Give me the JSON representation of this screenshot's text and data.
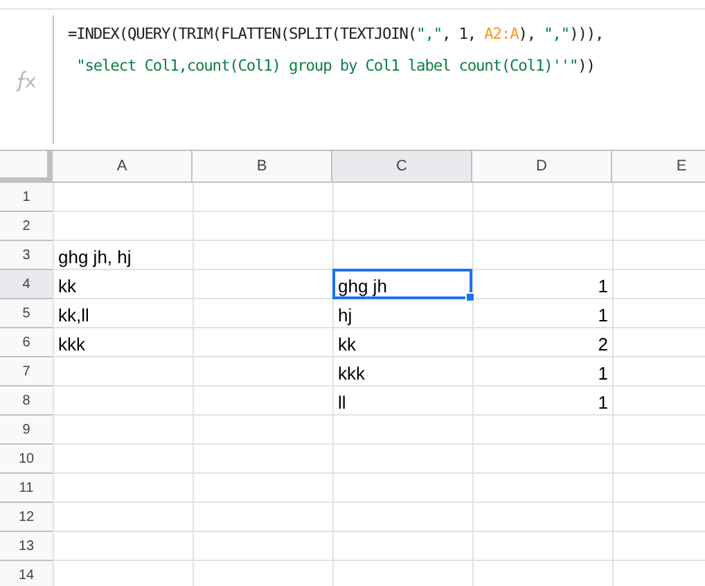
{
  "formula_bar": {
    "lines": [
      [
        {
          "kind": "plain",
          "text": "=INDEX(QUERY(TRIM(FLATTEN(SPLIT(TEXTJOIN("
        },
        {
          "kind": "string",
          "text": "\",\""
        },
        {
          "kind": "plain",
          "text": ", 1, "
        },
        {
          "kind": "range",
          "text": "A2:A"
        },
        {
          "kind": "plain",
          "text": "), "
        },
        {
          "kind": "string",
          "text": "\",\""
        },
        {
          "kind": "plain",
          "text": "))),"
        }
      ],
      [
        {
          "kind": "string",
          "text": " \"select Col1,count(Col1) group by Col1 label count(Col1)''\""
        },
        {
          "kind": "plain",
          "text": "))"
        }
      ]
    ]
  },
  "columns": [
    "A",
    "B",
    "C",
    "D",
    "E"
  ],
  "rows": [
    {
      "label": "1",
      "cells": [
        null,
        null,
        null,
        null,
        null
      ]
    },
    {
      "label": "2",
      "cells": [
        null,
        null,
        null,
        null,
        null
      ]
    },
    {
      "label": "3",
      "cells": [
        {
          "text": "ghg jh, hj",
          "kind": "text",
          "selected": false
        },
        null,
        null,
        null,
        null
      ]
    },
    {
      "label": "4",
      "cells": [
        {
          "text": "kk",
          "kind": "text",
          "selected": false
        },
        null,
        {
          "text": "ghg jh",
          "kind": "text",
          "selected": true
        },
        {
          "text": "1",
          "kind": "number",
          "selected": false
        },
        null
      ]
    },
    {
      "label": "5",
      "cells": [
        {
          "text": "kk,ll",
          "kind": "text",
          "selected": false
        },
        null,
        {
          "text": "hj",
          "kind": "text",
          "selected": false
        },
        {
          "text": "1",
          "kind": "number",
          "selected": false
        },
        null
      ]
    },
    {
      "label": "6",
      "cells": [
        {
          "text": "kkk",
          "kind": "text",
          "selected": false
        },
        null,
        {
          "text": "kk",
          "kind": "text",
          "selected": false
        },
        {
          "text": "2",
          "kind": "number",
          "selected": false
        },
        null
      ]
    },
    {
      "label": "7",
      "cells": [
        null,
        null,
        {
          "text": "kkk",
          "kind": "text",
          "selected": false
        },
        {
          "text": "1",
          "kind": "number",
          "selected": false
        },
        null
      ]
    },
    {
      "label": "8",
      "cells": [
        null,
        null,
        {
          "text": "ll",
          "kind": "text",
          "selected": false
        },
        {
          "text": "1",
          "kind": "number",
          "selected": false
        },
        null
      ]
    },
    {
      "label": "9",
      "cells": [
        null,
        null,
        null,
        null,
        null
      ]
    },
    {
      "label": "10",
      "cells": [
        null,
        null,
        null,
        null,
        null
      ]
    },
    {
      "label": "11",
      "cells": [
        null,
        null,
        null,
        null,
        null
      ]
    },
    {
      "label": "12",
      "cells": [
        null,
        null,
        null,
        null,
        null
      ]
    },
    {
      "label": "13",
      "cells": [
        null,
        null,
        null,
        null,
        null
      ]
    },
    {
      "label": "14",
      "cells": [
        null,
        null,
        null,
        null,
        null
      ]
    }
  ]
}
